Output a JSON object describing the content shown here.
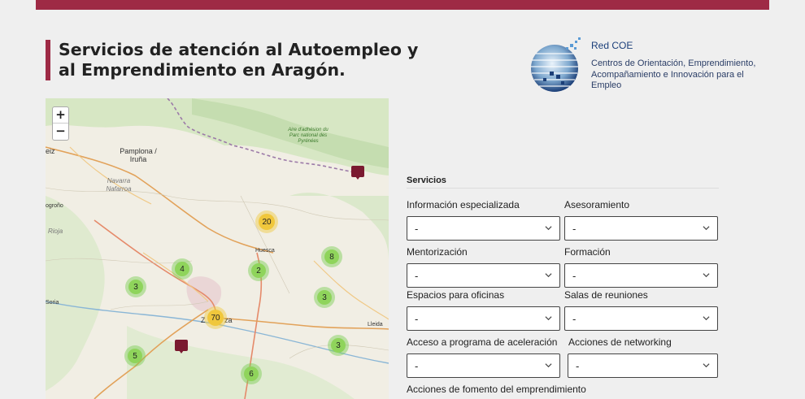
{
  "page": {
    "title": "Servicios de atención al Autoempleo y al Emprendimiento en Aragón.",
    "colors": {
      "accent": "#9e2a45",
      "marker": "#7a1a30",
      "cluster_small": "#8fd45b",
      "cluster_large": "#f0c73c"
    }
  },
  "logo": {
    "brand": "Red COE",
    "subtitle": "Centros de Orientación, Emprendimiento, Acompañamiento e Innovación para el Empleo"
  },
  "map": {
    "zoom_in": "+",
    "zoom_out": "−",
    "labels": {
      "pamplona": "Pamplona / Iruña",
      "navarra": "Navarra Nafarroa",
      "park": "Aire d'adhésion du Parc national des Pyrénées",
      "huesca": "Huesca",
      "zaragoza_pre": "Z",
      "zaragoza_post": "za",
      "lleida": "Lleida",
      "soria": "Soria",
      "rioja": "Rioja",
      "logrono": "ogroño",
      "eiz": "eiz"
    },
    "clusters": [
      {
        "count": "20"
      },
      {
        "count": "4"
      },
      {
        "count": "2"
      },
      {
        "count": "8"
      },
      {
        "count": "3"
      },
      {
        "count": "3"
      },
      {
        "count": "70"
      },
      {
        "count": "5"
      },
      {
        "count": "3"
      },
      {
        "count": "6"
      }
    ]
  },
  "filters": {
    "section_title": "Servicios",
    "fields": [
      {
        "label": "Información especializada",
        "value": "-"
      },
      {
        "label": "Asesoramiento",
        "value": "-"
      },
      {
        "label": "Mentorización",
        "value": "-"
      },
      {
        "label": "Formación",
        "value": "-"
      },
      {
        "label": "Espacios para oficinas",
        "value": "-"
      },
      {
        "label": "Salas de reuniones",
        "value": "-"
      },
      {
        "label": "Acceso a programa de aceleración",
        "value": "-"
      },
      {
        "label": "Acciones de networking",
        "value": "-"
      },
      {
        "label": "Acciones de fomento del emprendimiento"
      }
    ]
  }
}
